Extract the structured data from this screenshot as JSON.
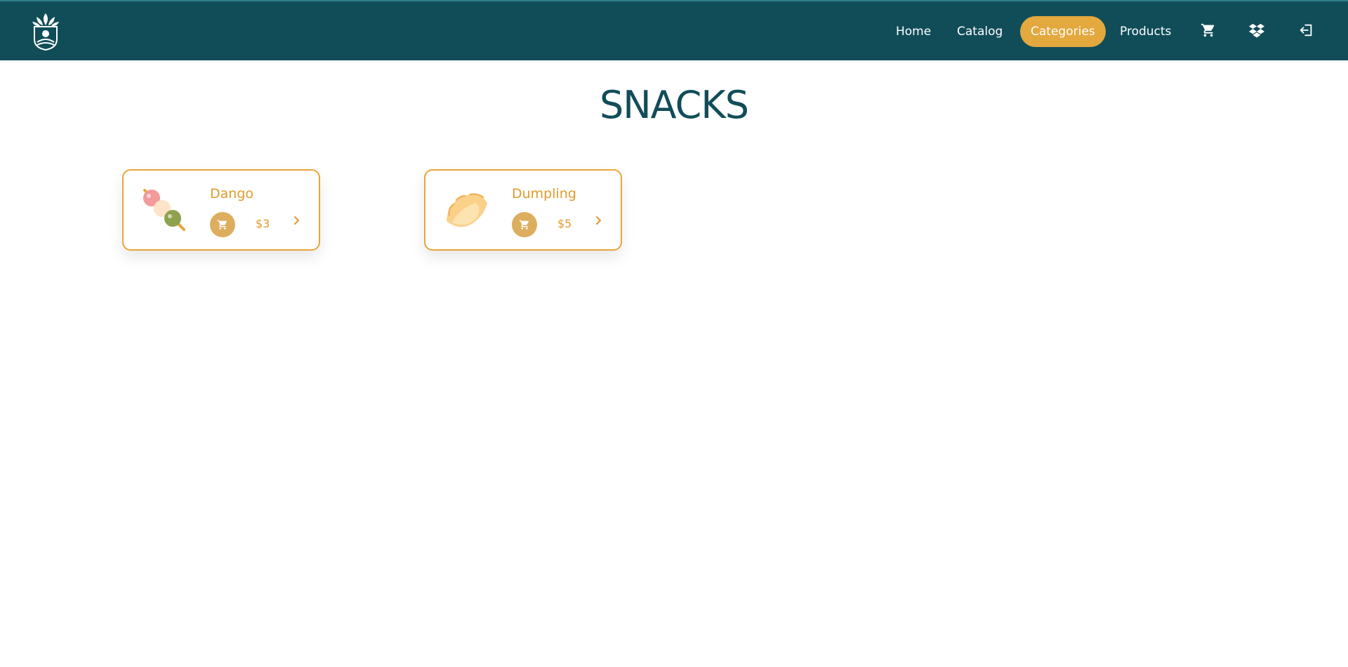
{
  "nav": {
    "logo": "leaf-logo-icon",
    "items": [
      {
        "label": "Home"
      },
      {
        "label": "Catalog"
      },
      {
        "label": "Categories",
        "active": true
      },
      {
        "label": "Products"
      }
    ],
    "icons": [
      "cart-icon",
      "dropbox-icon",
      "logout-icon"
    ],
    "accent_color": "#e3a83e",
    "background_color": "#114d59"
  },
  "page": {
    "title": "SNACKS"
  },
  "products": [
    {
      "name": "Dango",
      "price": "$3",
      "image": "dango-icon"
    },
    {
      "name": "Dumpling",
      "price": "$5",
      "image": "dumpling-icon"
    }
  ]
}
